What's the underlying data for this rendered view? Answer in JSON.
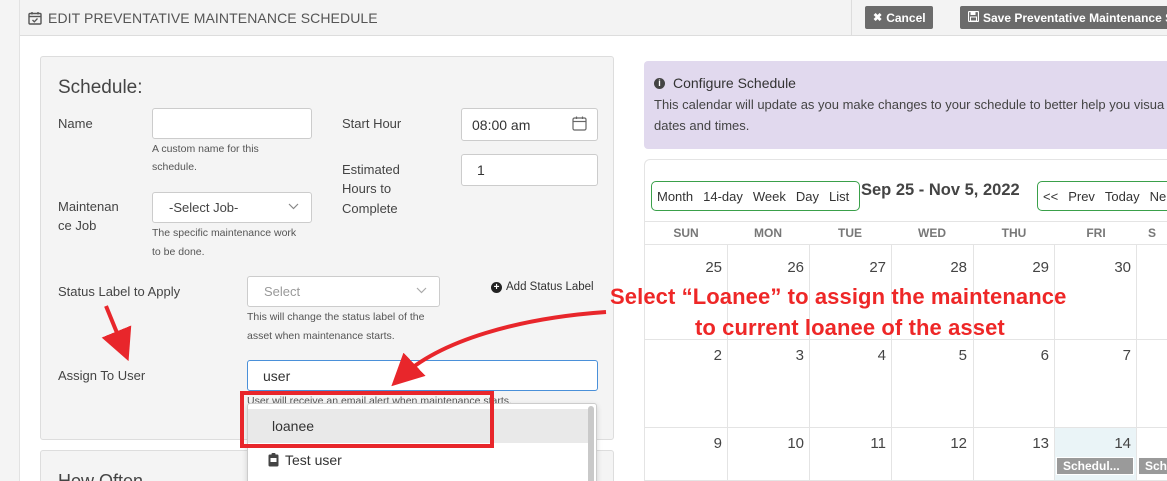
{
  "header": {
    "title": "EDIT PREVENTATIVE MAINTENANCE SCHEDULE",
    "cancel_label": "Cancel",
    "save_label": "Save Preventative Maintenance S"
  },
  "form": {
    "section_title": "Schedule:",
    "name_label": "Name",
    "name_value": "",
    "name_help_1": "A custom name for this",
    "name_help_2": "schedule.",
    "start_hour_label": "Start Hour",
    "start_hour_value": "08:00 am",
    "est_hours_label_1": "Estimated",
    "est_hours_label_2": "Hours to",
    "est_hours_label_3": "Complete",
    "est_hours_value": "1",
    "job_label_1": "Maintenan",
    "job_label_2": "ce Job",
    "job_value": "-Select Job-",
    "job_help_1": "The specific maintenance work",
    "job_help_2": "to be done.",
    "status_label": "Status Label to Apply",
    "status_placeholder": "Select",
    "status_help_1": "This will change the status label of the",
    "status_help_2": "asset when maintenance starts.",
    "add_status_label": "Add Status Label",
    "assign_label": "Assign To User",
    "assign_value": "user",
    "assign_help": "User will receive an email alert when maintenance starts.",
    "next_section_title": "How Often"
  },
  "dropdown": {
    "items": [
      {
        "label": "loanee",
        "highlighted": true
      },
      {
        "label": "Test user",
        "icon": "badge-icon"
      }
    ]
  },
  "configure": {
    "title": "Configure Schedule",
    "body_1": "This calendar will update as you make changes to your schedule to better help you visua",
    "body_2": "dates and times."
  },
  "calendar": {
    "view_buttons": [
      "Month",
      "14-day",
      "Week",
      "Day",
      "List"
    ],
    "range": "Sep 25 - Nov 5, 2022",
    "nav_buttons": [
      "<<",
      "Prev",
      "Today",
      "Ne"
    ],
    "weekdays": [
      "SUN",
      "MON",
      "TUE",
      "WED",
      "THU",
      "FRI",
      "S"
    ],
    "weeks": [
      [
        "25",
        "26",
        "27",
        "28",
        "29",
        "30"
      ],
      [
        "2",
        "3",
        "4",
        "5",
        "6",
        "7"
      ],
      [
        "9",
        "10",
        "11",
        "12",
        "13",
        "14"
      ]
    ],
    "events": [
      "Schedul...",
      "Sch"
    ]
  },
  "annotation": {
    "line_1": "Select “Loanee” to assign the maintenance",
    "line_2": "to current loanee of the asset",
    "color": "#ee2727"
  }
}
